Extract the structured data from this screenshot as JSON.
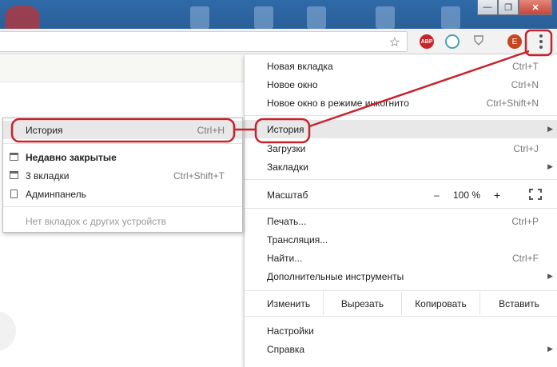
{
  "colors": {
    "accent_annotation": "#c8232c",
    "menu_highlight": "#e8e8e8",
    "titlebar": "#2f6aa8"
  },
  "window": {
    "minimize_icon": "minimize-icon",
    "maximize_icon": "maximize-icon",
    "close_icon": "close-icon"
  },
  "toolbar": {
    "bookmark_icon": "star-icon",
    "extensions": [
      {
        "name": "adblock-plus-icon",
        "text": "ABP"
      },
      {
        "name": "extension-circle-icon",
        "text": ""
      },
      {
        "name": "shield-icon",
        "text": ""
      }
    ],
    "avatar_letter": "E",
    "menu_icon": "kebab-menu-icon"
  },
  "menu": {
    "new_tab": {
      "label": "Новая вкладка",
      "shortcut": "Ctrl+T"
    },
    "new_window": {
      "label": "Новое окно",
      "shortcut": "Ctrl+N"
    },
    "incognito": {
      "label": "Новое окно в режиме инкогнито",
      "shortcut": "Ctrl+Shift+N"
    },
    "history": {
      "label": "История"
    },
    "downloads": {
      "label": "Загрузки",
      "shortcut": "Ctrl+J"
    },
    "bookmarks": {
      "label": "Закладки"
    },
    "zoom": {
      "label": "Масштаб",
      "minus": "–",
      "value": "100 %",
      "plus": "+"
    },
    "print": {
      "label": "Печать...",
      "shortcut": "Ctrl+P"
    },
    "cast": {
      "label": "Трансляция..."
    },
    "find": {
      "label": "Найти...",
      "shortcut": "Ctrl+F"
    },
    "more_tools": {
      "label": "Дополнительные инструменты"
    },
    "edit": {
      "label": "Изменить",
      "cut": "Вырезать",
      "copy": "Копировать",
      "paste": "Вставить"
    },
    "settings": {
      "label": "Настройки"
    },
    "help": {
      "label": "Справка"
    }
  },
  "history_submenu": {
    "history": {
      "label": "История",
      "shortcut": "Ctrl+H"
    },
    "recently_closed": {
      "label": "Недавно закрытые"
    },
    "tabs3": {
      "label": "3 вкладки",
      "shortcut": "Ctrl+Shift+T"
    },
    "admin": {
      "label": "Админпанель"
    },
    "no_tabs": {
      "label": "Нет вкладок с других устройств"
    }
  }
}
